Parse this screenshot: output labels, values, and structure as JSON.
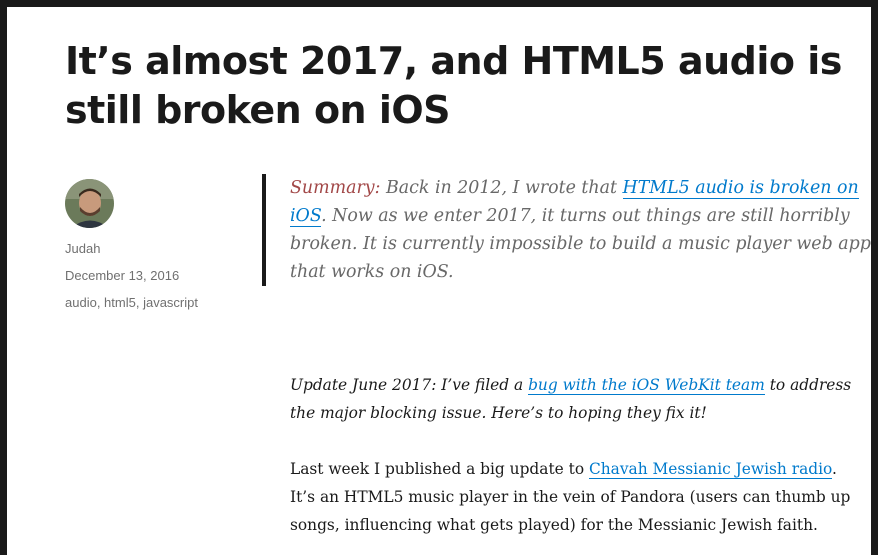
{
  "article": {
    "title": "It’s almost 2017, and HTML5 audio is still broken on iOS"
  },
  "meta": {
    "author": "Judah",
    "date": "December 13, 2016",
    "tags": [
      "audio",
      "html5",
      "javascript"
    ],
    "tag_separator": ", "
  },
  "summary": {
    "label": "Summary:",
    "text_before_link": " Back in 2012, I wrote that ",
    "link_text": "HTML5 audio is broken on iOS",
    "text_after_link": ". Now as we enter 2017, it turns out things are still horribly broken. It is currently impossible to build a music player web app that works on iOS."
  },
  "update": {
    "text_before_link": "Update June 2017: I’ve filed a ",
    "link_text": "bug with the iOS WebKit team",
    "text_after_link": " to address the major blocking issue. Here’s to hoping they fix it!"
  },
  "paragraph1": {
    "text_before_link": "Last week I published a big update to ",
    "link_text": "Chavah Messianic Jewish radio",
    "text_after_link": ". It’s an HTML5 music player in the vein of Pandora (users can thumb up songs, influencing what gets played) for the Messianic Jewish faith."
  },
  "colors": {
    "link": "#007acc",
    "summary_label": "#a24848",
    "meta_text": "#707070",
    "frame": "#1a1a1a"
  }
}
